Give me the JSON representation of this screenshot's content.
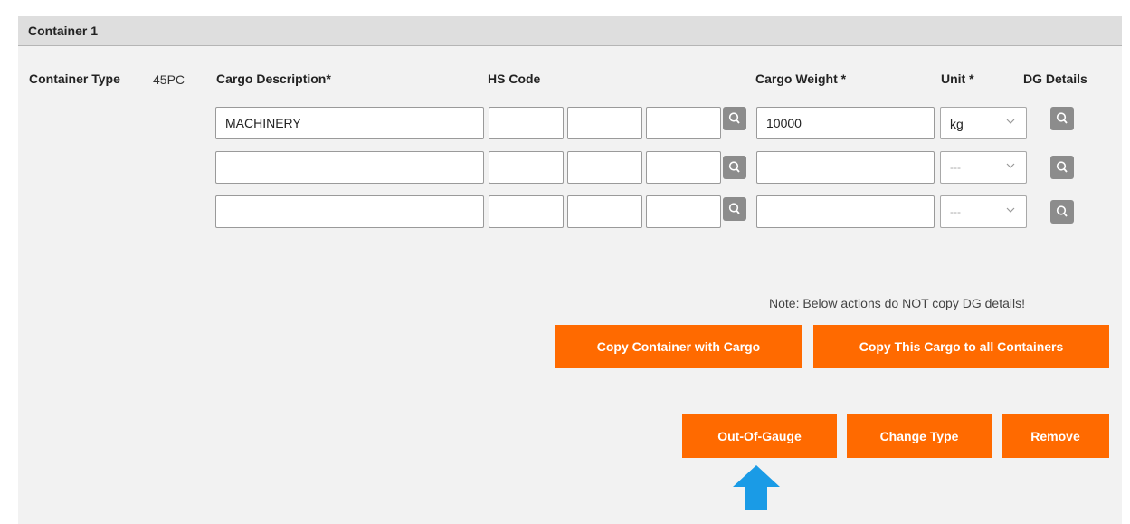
{
  "container": {
    "title": "Container 1",
    "type_label": "Container Type",
    "type_value": "45PC"
  },
  "columns": {
    "cargo_description": "Cargo Description*",
    "hs_code": "HS Code",
    "cargo_weight": "Cargo Weight *",
    "unit": "Unit *",
    "dg_details": "DG Details"
  },
  "rows": [
    {
      "description": "MACHINERY",
      "hs1": "",
      "hs2": "",
      "hs3": "",
      "weight": "10000",
      "unit": "kg"
    },
    {
      "description": "",
      "hs1": "",
      "hs2": "",
      "hs3": "",
      "weight": "",
      "unit": "---"
    },
    {
      "description": "",
      "hs1": "",
      "hs2": "",
      "hs3": "",
      "weight": "",
      "unit": "---"
    }
  ],
  "note": "Note: Below actions do NOT copy DG details!",
  "buttons": {
    "copy_container": "Copy Container with Cargo",
    "copy_cargo": "Copy This Cargo to all Containers",
    "out_of_gauge": "Out-Of-Gauge",
    "change_type": "Change Type",
    "remove": "Remove"
  },
  "colors": {
    "accent": "#ff6a00",
    "arrow": "#1a9be6",
    "search_button": "#8c8c8c"
  },
  "icons": {
    "search": "search-icon",
    "chevron": "chevron-down-icon",
    "pointer": "arrow-up-icon"
  }
}
